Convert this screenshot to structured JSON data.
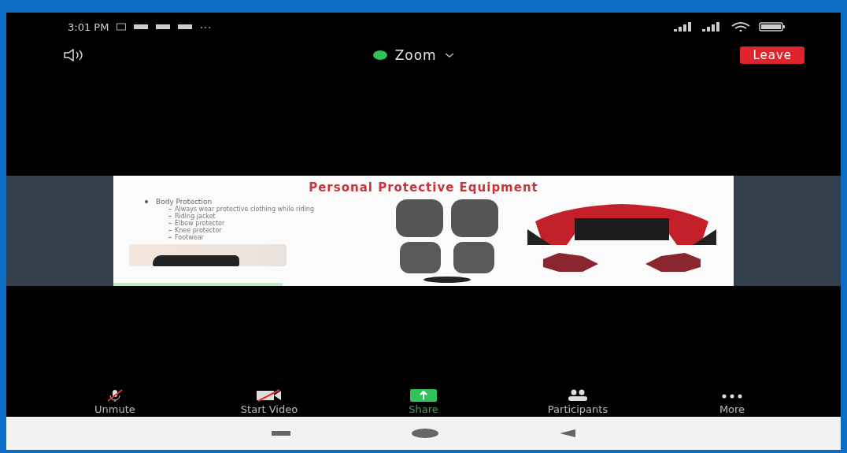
{
  "status_bar": {
    "time": "3:01 PM"
  },
  "top_bar": {
    "title": "Zoom",
    "leave_button": "Leave"
  },
  "shared_slide": {
    "title": "Personal Protective Equipment",
    "bullet": "Body Protection",
    "sub_bullets": [
      "Always wear protective clothing while riding",
      "Riding jacket",
      "Elbow protector",
      "Knee protector",
      "Footwear"
    ]
  },
  "toolbar": [
    {
      "label": "Unmute",
      "kind": "mic"
    },
    {
      "label": "Start Video",
      "kind": "video"
    },
    {
      "label": "Share",
      "kind": "share"
    },
    {
      "label": "Participants",
      "kind": "participants"
    },
    {
      "label": "More",
      "kind": "more"
    }
  ]
}
